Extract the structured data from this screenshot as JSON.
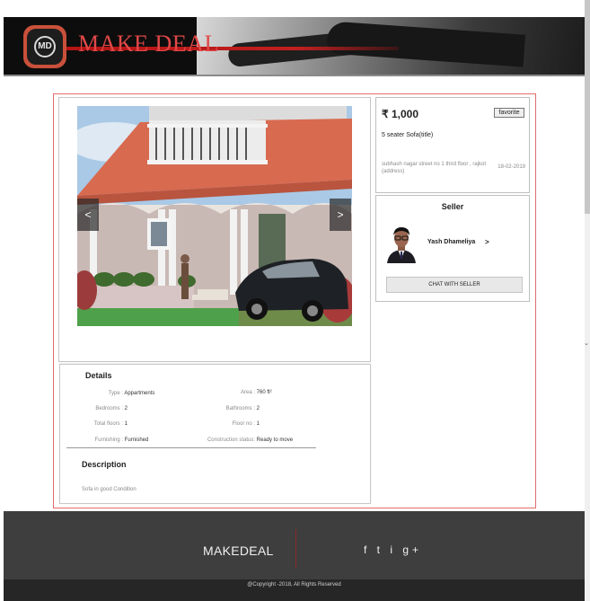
{
  "header": {
    "logo_text": "MD",
    "brand": "MAKE DEAL"
  },
  "gallery": {
    "prev": "<",
    "next": ">"
  },
  "listing": {
    "price": "₹ 1,000",
    "favorite_label": "favorite",
    "title": "5 seater Sofa(title)",
    "address": "subhash nagar street no 1 third floor , rajkot (address)",
    "date": "18-02-2019"
  },
  "seller": {
    "heading": "Seller",
    "name": "Yash Dhameliya",
    "arrow": ">",
    "chat_label": "CHAT WITH SELLER"
  },
  "details": {
    "heading": "Details",
    "rows": [
      {
        "label": "Type :",
        "value": "Appartments"
      },
      {
        "label": "Area :",
        "value": "760 ft²"
      },
      {
        "label": "Bedrooms :",
        "value": "2"
      },
      {
        "label": "Bathrooms :",
        "value": "2"
      },
      {
        "label": "Total floors :",
        "value": "1"
      },
      {
        "label": "Floor no :",
        "value": "1"
      },
      {
        "label": "Furnishing :",
        "value": "Furnished"
      },
      {
        "label": "Construction status:",
        "value": "Ready to move"
      }
    ]
  },
  "description": {
    "heading": "Description",
    "text": "Sofa in good Condition"
  },
  "footer": {
    "brand": "MAKEDEAL",
    "social": "f t i g+",
    "copyright": "@Copyright -2018, All Rights Reserved"
  },
  "scroll": {
    "arrow": "⌄"
  }
}
